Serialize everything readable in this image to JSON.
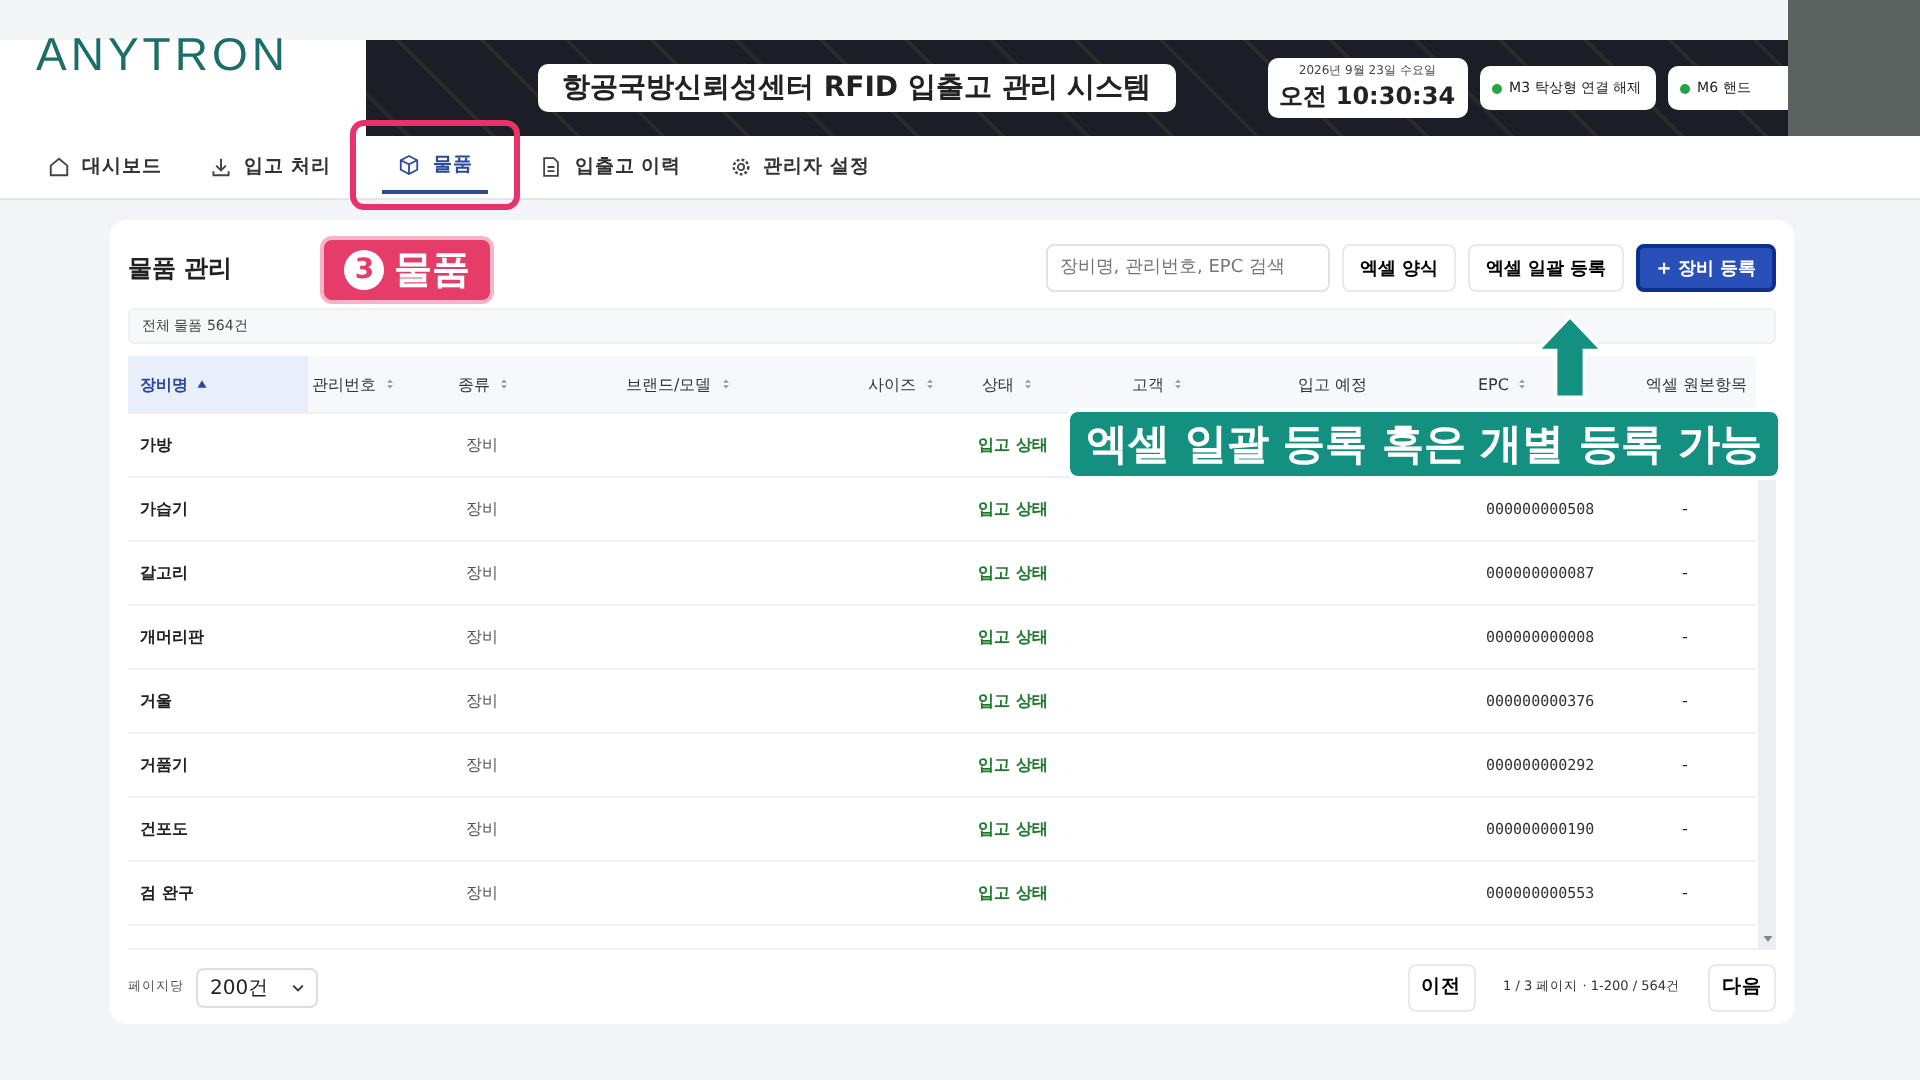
{
  "header": {
    "logo": "ANYTRON",
    "system_title": "항공국방신뢰성센터 RFID 입출고 관리 시스템",
    "date": "2026년 9월 23일 수요일",
    "time": "오전 10:30:34",
    "devices": [
      {
        "label": "M3 탁상형 연결 해제",
        "color": "#22a447"
      },
      {
        "label": "M6 핸드",
        "color": "#22a447"
      }
    ]
  },
  "tabs": [
    {
      "label": "대시보드",
      "selected": false,
      "highlighted": false
    },
    {
      "label": "입고 처리",
      "selected": false,
      "highlighted": false
    },
    {
      "label": "물품",
      "selected": true,
      "highlighted": true
    },
    {
      "label": "입출고 이력",
      "selected": false,
      "highlighted": false
    },
    {
      "label": "관리자 설정",
      "selected": false,
      "highlighted": false
    }
  ],
  "panel": {
    "title": "물품 관리",
    "search": {
      "placeholder": "장비명, 관리번호, EPC 검색"
    },
    "buttons": [
      {
        "label": "엑셀 양식",
        "kind": "plain"
      },
      {
        "label": "엑셀 일괄 등록",
        "kind": "plain"
      },
      {
        "label": "+ 장비 등록",
        "kind": "primary"
      }
    ],
    "total": "전체 물품 564건"
  },
  "table": {
    "columns": [
      {
        "label": "장비명",
        "sortable": true,
        "sorted": true
      },
      {
        "label": "관리번호",
        "sortable": true,
        "sorted": false
      },
      {
        "label": "종류",
        "sortable": true,
        "sorted": false
      },
      {
        "label": "브랜드/모델",
        "sortable": true,
        "sorted": false
      },
      {
        "label": "사이즈",
        "sortable": true,
        "sorted": false
      },
      {
        "label": "상태",
        "sortable": true,
        "sorted": false
      },
      {
        "label": "고객",
        "sortable": true,
        "sorted": false
      },
      {
        "label": "입고 예정",
        "sortable": false,
        "sorted": false
      },
      {
        "label": "EPC",
        "sortable": true,
        "sorted": false
      },
      {
        "label": "엑셀 원본항목",
        "sortable": false,
        "sorted": false
      }
    ],
    "rows": [
      {
        "name": "가방",
        "type": "장비",
        "status": "입고 상태"
      },
      {
        "name": "가습기",
        "type": "장비",
        "status": "입고 상태",
        "epc": "000000000508",
        "excel": "-"
      },
      {
        "name": "갈고리",
        "type": "장비",
        "status": "입고 상태",
        "epc": "000000000087",
        "excel": "-"
      },
      {
        "name": "개머리판",
        "type": "장비",
        "status": "입고 상태",
        "epc": "000000000008",
        "excel": "-"
      },
      {
        "name": "거울",
        "type": "장비",
        "status": "입고 상태",
        "epc": "000000000376",
        "excel": "-"
      },
      {
        "name": "거품기",
        "type": "장비",
        "status": "입고 상태",
        "epc": "000000000292",
        "excel": "-"
      },
      {
        "name": "건포도",
        "type": "장비",
        "status": "입고 상태",
        "epc": "000000000190",
        "excel": "-"
      },
      {
        "name": "검 완구",
        "type": "장비",
        "status": "입고 상태",
        "epc": "000000000553",
        "excel": "-"
      }
    ]
  },
  "pagination": {
    "per_page_label": "페이지당",
    "per_page": "200건",
    "prev": "이전",
    "info": "1 / 3 페이지 · 1-200 / 564건",
    "next": "다음"
  },
  "annotations": {
    "step_number": "3",
    "step_label": "물품",
    "callout": "엑셀 일괄 등록 혹은 개별 등록 가능"
  }
}
